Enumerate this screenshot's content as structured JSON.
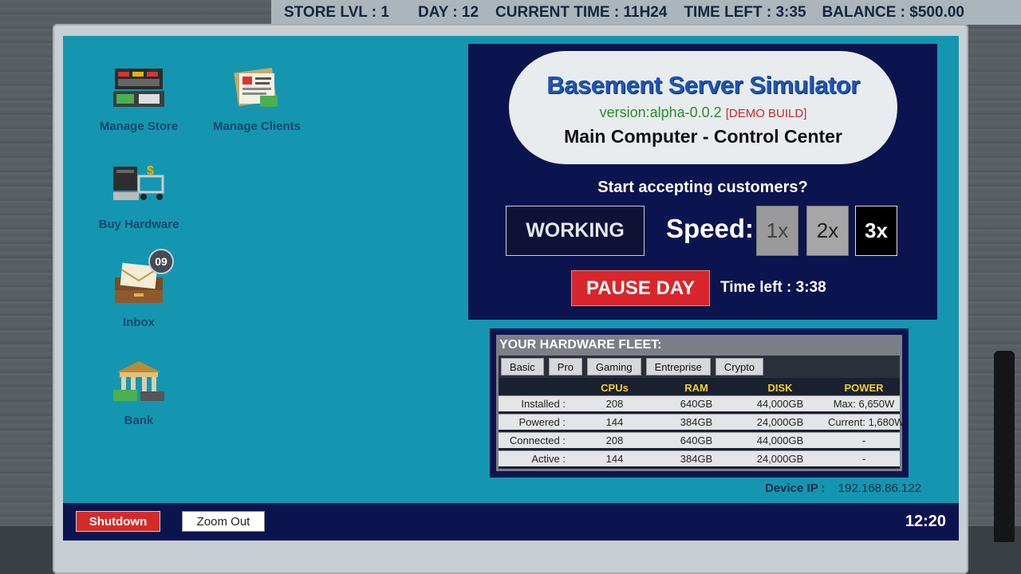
{
  "hud": {
    "store_lvl_label": "STORE LVL : ",
    "store_lvl": "1",
    "day_label": "DAY : ",
    "day": "12",
    "time_label": "CURRENT TIME : ",
    "time": "11H24",
    "time_left_label": "TIME LEFT : ",
    "time_left": "3:35",
    "balance_label": "BALANCE : ",
    "balance": "$500.00"
  },
  "desktop": {
    "icons": [
      {
        "label": "Manage Store",
        "icon": "store-icon"
      },
      {
        "label": "Manage Clients",
        "icon": "clients-icon"
      },
      {
        "label": "Buy Hardware",
        "icon": "hardware-cart-icon"
      },
      {
        "label": "Inbox",
        "icon": "inbox-icon",
        "badge": "09"
      },
      {
        "label": "Bank",
        "icon": "bank-icon"
      }
    ]
  },
  "control": {
    "game_title": "Basement Server Simulator",
    "version": "version:alpha-0.0.2",
    "demo_tag": "[DEMO BUILD]",
    "subtitle": "Main Computer - Control Center",
    "prompt": "Start accepting customers?",
    "working_label": "WORKING",
    "speed_label": "Speed:",
    "speed_options": [
      "1x",
      "2x",
      "3x"
    ],
    "speed_selected": "3x",
    "pause_label": "PAUSE DAY",
    "time_left_text": "Time left : 3:38"
  },
  "fleet": {
    "title": "YOUR HARDWARE FLEET:",
    "tabs": [
      "Basic",
      "Pro",
      "Gaming",
      "Entreprise",
      "Crypto"
    ],
    "headers": [
      "",
      "CPUs",
      "RAM",
      "DISK",
      "POWER"
    ],
    "rows": [
      [
        "Installed :",
        "208",
        "640GB",
        "44,000GB",
        "Max: 6,650W"
      ],
      [
        "Powered :",
        "144",
        "384GB",
        "24,000GB",
        "Current: 1,680W"
      ],
      [
        "Connected :",
        "208",
        "640GB",
        "44,000GB",
        "-"
      ],
      [
        "Active :",
        "144",
        "384GB",
        "24,000GB",
        "-"
      ]
    ]
  },
  "device_ip_label": "Device IP :",
  "device_ip": "192.168.86.122",
  "taskbar": {
    "shutdown_label": "Shutdown",
    "zoom_out_label": "Zoom Out",
    "clock": "12:20"
  },
  "colors": {
    "desktop_bg": "#1496b0",
    "panel_bg": "#0c1450",
    "pause_red": "#d8262c",
    "header_yellow": "#f2d228"
  }
}
